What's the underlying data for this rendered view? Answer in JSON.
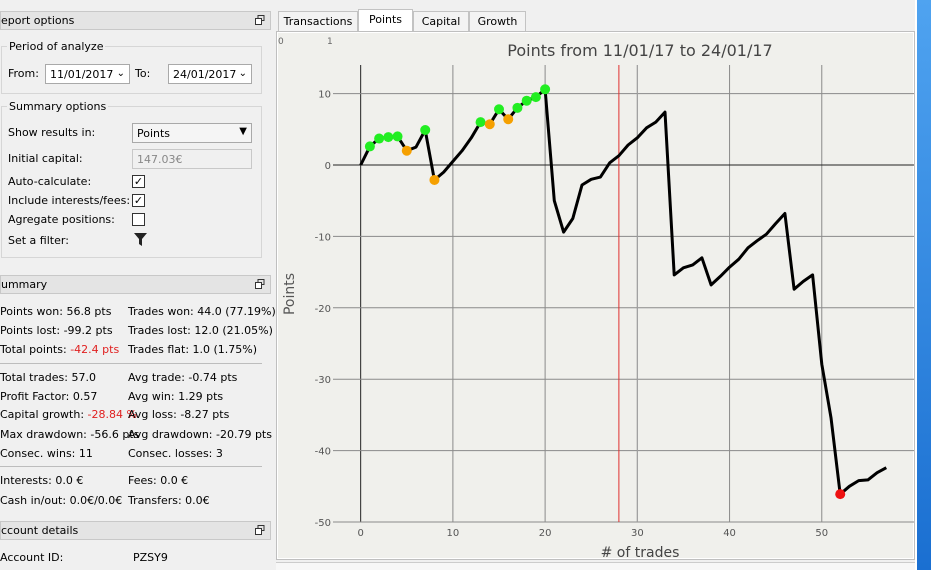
{
  "report_options": {
    "title": "eport options",
    "period": {
      "legend": "Period of analyze",
      "from_label": "From:",
      "from_value": "11/01/2017",
      "to_label": "To:",
      "to_value": "24/01/2017"
    },
    "summary_options": {
      "legend": "Summary options",
      "show_results_label": "Show results in:",
      "show_results_value": "Points",
      "initial_capital_label": "Initial capital:",
      "initial_capital_value": "147.03€",
      "auto_calculate_label": "Auto-calculate:",
      "auto_calculate": true,
      "include_interests_label": "Include interests/fees:",
      "include_interests": true,
      "aggregate_label": "Agregate positions:",
      "aggregate": false,
      "filter_label": "Set a filter:"
    }
  },
  "summary": {
    "title": "ummary",
    "points_won": "Points won: 56.8 pts",
    "trades_won": "Trades won: 44.0 (77.19%)",
    "points_lost": "Points lost: -99.2 pts",
    "trades_lost": "Trades lost: 12.0 (21.05%)",
    "total_points_label": "Total points: ",
    "total_points_value": "-42.4 pts",
    "trades_flat": "Trades flat: 1.0 (1.75%)",
    "total_trades": "Total trades: 57.0",
    "avg_trade": "Avg trade: -0.74 pts",
    "profit_factor": "Profit Factor: 0.57",
    "avg_win": "Avg win: 1.29 pts",
    "capital_growth_label": "Capital growth: ",
    "capital_growth_value": "-28.84 %",
    "avg_loss": "Avg loss: -8.27 pts",
    "max_drawdown": "Max drawdown: -56.6 pts",
    "avg_drawdown": "Avg drawdown: -20.79 pts",
    "consec_wins": "Consec. wins: 11",
    "consec_losses": "Consec. losses: 3",
    "interests": "Interests: 0.0 €",
    "fees": "Fees: 0.0 €",
    "cash": "Cash in/out: 0.0€/0.0€",
    "transfers": "Transfers: 0.0€"
  },
  "account": {
    "title": "ccount details",
    "id_label": "Account ID:",
    "id_value": "PZSY9"
  },
  "tabs": [
    "Transactions",
    "Points",
    "Capital",
    "Growth"
  ],
  "active_tab": "Points",
  "corner_labels": [
    "0",
    "1"
  ],
  "chart_data": {
    "type": "line",
    "title": "Points from 11/01/17 to 24/01/17",
    "xlabel": "# of trades",
    "ylabel": "Points",
    "xlim": [
      -3,
      60
    ],
    "ylim": [
      -50,
      14
    ],
    "xticks": [
      0,
      10,
      20,
      30,
      40,
      50
    ],
    "yticks": [
      10,
      0,
      -10,
      -20,
      -30,
      -40,
      -50
    ],
    "vertical_marker_x": 28,
    "series": [
      {
        "points": [
          [
            0,
            0
          ],
          [
            1,
            2.6
          ],
          [
            2,
            3.7
          ],
          [
            3,
            3.9
          ],
          [
            4,
            4
          ],
          [
            5,
            2
          ],
          [
            6,
            2.5
          ],
          [
            7,
            4.9
          ],
          [
            8,
            -2.1
          ],
          [
            9,
            -1
          ],
          [
            10,
            0.5
          ],
          [
            11,
            2
          ],
          [
            12,
            3.8
          ],
          [
            13,
            6
          ],
          [
            14,
            5.7
          ],
          [
            15,
            7.8
          ],
          [
            16,
            6.4
          ],
          [
            17,
            8
          ],
          [
            18,
            9
          ],
          [
            19,
            9.5
          ],
          [
            20,
            10.6
          ],
          [
            21,
            -5
          ],
          [
            22,
            -9.4
          ],
          [
            23,
            -7.5
          ],
          [
            24,
            -2.8
          ],
          [
            25,
            -2
          ],
          [
            26,
            -1.7
          ],
          [
            27,
            0.3
          ],
          [
            28,
            1.3
          ],
          [
            29,
            2.8
          ],
          [
            30,
            3.8
          ],
          [
            31,
            5.2
          ],
          [
            32,
            6
          ],
          [
            33,
            7.4
          ],
          [
            34,
            -15.4
          ],
          [
            35,
            -14.4
          ],
          [
            36,
            -14
          ],
          [
            37,
            -13
          ],
          [
            38,
            -16.8
          ],
          [
            39,
            -15.6
          ],
          [
            40,
            -14.3
          ],
          [
            41,
            -13.2
          ],
          [
            42,
            -11.6
          ],
          [
            43,
            -10.6
          ],
          [
            44,
            -9.7
          ],
          [
            45,
            -8.2
          ],
          [
            46,
            -6.8
          ],
          [
            47,
            -17.4
          ],
          [
            48,
            -16.3
          ],
          [
            49,
            -15.4
          ],
          [
            50,
            -27.9
          ],
          [
            51,
            -35.4
          ],
          [
            52,
            -46.1
          ],
          [
            53,
            -45
          ],
          [
            54,
            -44.2
          ],
          [
            55,
            -44.1
          ],
          [
            56,
            -43.1
          ],
          [
            57,
            -42.4
          ]
        ]
      }
    ],
    "markers": [
      {
        "x": 1,
        "y": 2.6,
        "color": "#22ee22"
      },
      {
        "x": 2,
        "y": 3.7,
        "color": "#22ee22"
      },
      {
        "x": 3,
        "y": 3.9,
        "color": "#22ee22"
      },
      {
        "x": 4,
        "y": 4,
        "color": "#22ee22"
      },
      {
        "x": 5,
        "y": 2,
        "color": "#f5a000"
      },
      {
        "x": 7,
        "y": 4.9,
        "color": "#22ee22"
      },
      {
        "x": 8,
        "y": -2.1,
        "color": "#f5a000"
      },
      {
        "x": 13,
        "y": 6,
        "color": "#22ee22"
      },
      {
        "x": 14,
        "y": 5.7,
        "color": "#f5a000"
      },
      {
        "x": 15,
        "y": 7.8,
        "color": "#22ee22"
      },
      {
        "x": 16,
        "y": 6.4,
        "color": "#f5a000"
      },
      {
        "x": 17,
        "y": 8,
        "color": "#22ee22"
      },
      {
        "x": 18,
        "y": 9,
        "color": "#22ee22"
      },
      {
        "x": 19,
        "y": 9.5,
        "color": "#22ee22"
      },
      {
        "x": 20,
        "y": 10.6,
        "color": "#22ee22"
      },
      {
        "x": 52,
        "y": -46.1,
        "color": "#ee1111"
      }
    ],
    "grid": true
  }
}
